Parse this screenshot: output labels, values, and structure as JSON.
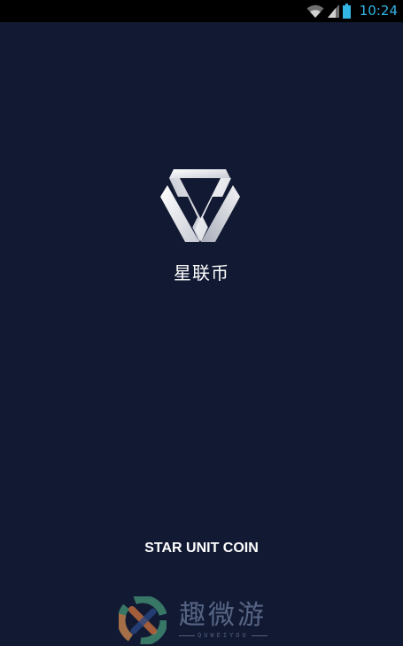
{
  "status_bar": {
    "time": "10:24",
    "icons": [
      "wifi-icon",
      "signal-icon",
      "battery-icon"
    ],
    "accent_color": "#33b5e5"
  },
  "splash": {
    "app_name": "星联币",
    "tagline": "STAR UNIT COIN",
    "background_color": "#121a33"
  },
  "watermark": {
    "title": "趣微游",
    "subtitle": "QUWEIYOU"
  }
}
